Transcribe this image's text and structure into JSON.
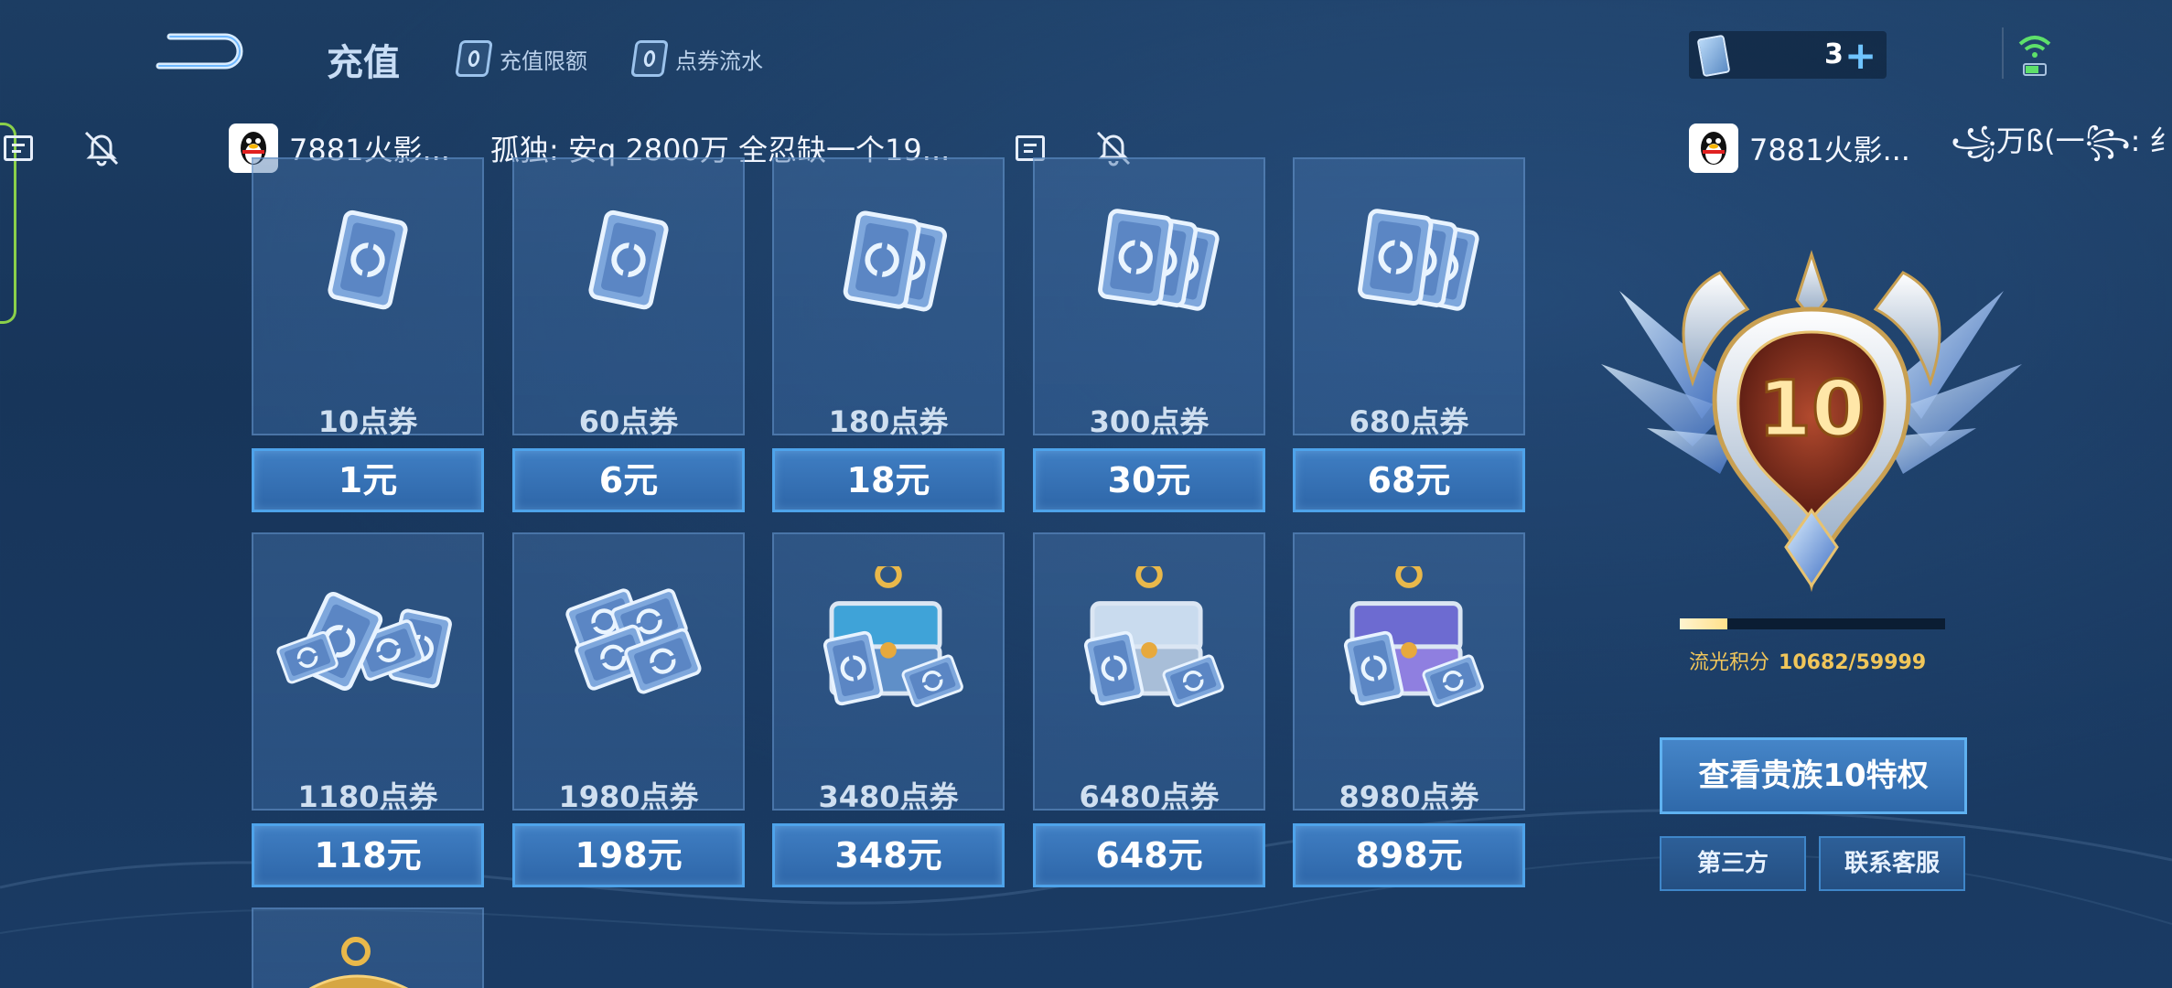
{
  "header": {
    "title": "充值",
    "links": [
      "充值限额",
      "点券流水"
    ],
    "currency_count": "3",
    "currency_plus": "+"
  },
  "chat": {
    "items": [
      {
        "sender": "7881火影...",
        "message": "孤独: 安q 2800万 全忍缺一个19..."
      },
      {
        "sender": "7881火影...",
        "message": "꧁万ß(一꧂: 纟"
      }
    ]
  },
  "products": [
    {
      "amount": "10点券",
      "price": "1元",
      "art": "card-1"
    },
    {
      "amount": "60点券",
      "price": "6元",
      "art": "card-1"
    },
    {
      "amount": "180点券",
      "price": "18元",
      "art": "card-2"
    },
    {
      "amount": "300点券",
      "price": "30元",
      "art": "card-3"
    },
    {
      "amount": "680点券",
      "price": "68元",
      "art": "card-3"
    },
    {
      "amount": "1180点券",
      "price": "118元",
      "art": "card-pile"
    },
    {
      "amount": "1980点券",
      "price": "198元",
      "art": "card-stack"
    },
    {
      "amount": "3480点券",
      "price": "348元",
      "art": "chest-blue"
    },
    {
      "amount": "6480点券",
      "price": "648元",
      "art": "chest-silver"
    },
    {
      "amount": "8980点券",
      "price": "898元",
      "art": "chest-purple"
    }
  ],
  "noble": {
    "level": "10",
    "points_label": "流光积分",
    "points_value": "10682/59999",
    "progress": 0.178,
    "privilege_button": "查看贵族10特权",
    "third_party_button": "第三方",
    "support_button": "联系客服"
  },
  "colors": {
    "accent": "#4ea3ea",
    "gold": "#f1c65a",
    "online": "#5ee06a"
  }
}
